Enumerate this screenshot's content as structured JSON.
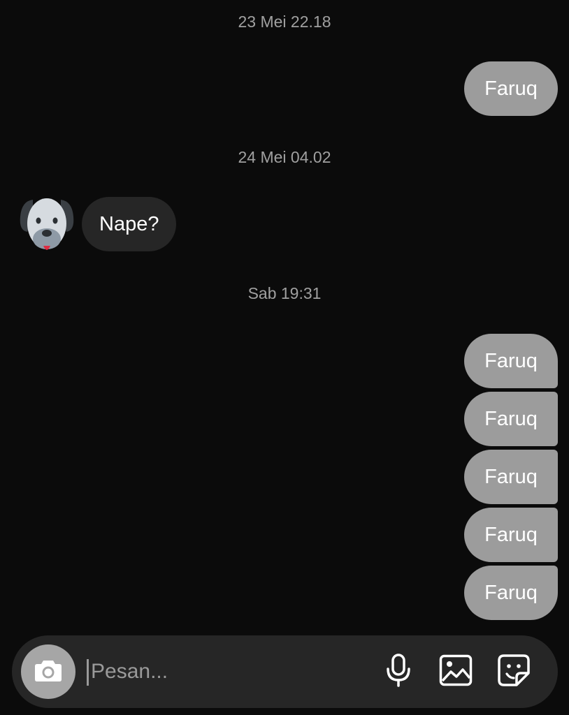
{
  "conversation": {
    "timestamps": [
      "23 Mei 22.18",
      "24 Mei 04.02",
      "Sab 19:31"
    ],
    "outgoing": [
      "Faruq",
      "Faruq",
      "Faruq",
      "Faruq",
      "Faruq",
      "Faruq"
    ],
    "incoming": [
      {
        "text": "Nape?",
        "avatar_icon": "dog-face-icon"
      }
    ]
  },
  "composer": {
    "placeholder": "Pesan...",
    "value": "",
    "camera_icon": "camera-icon",
    "mic_icon": "microphone-icon",
    "gallery_icon": "image-icon",
    "sticker_icon": "sticker-icon"
  },
  "colors": {
    "background": "#0b0b0b",
    "outgoing_bubble": "#9c9c9c",
    "incoming_bubble": "#262626",
    "timestamp_text": "#a0a0a0",
    "composer_bg": "#262626"
  }
}
